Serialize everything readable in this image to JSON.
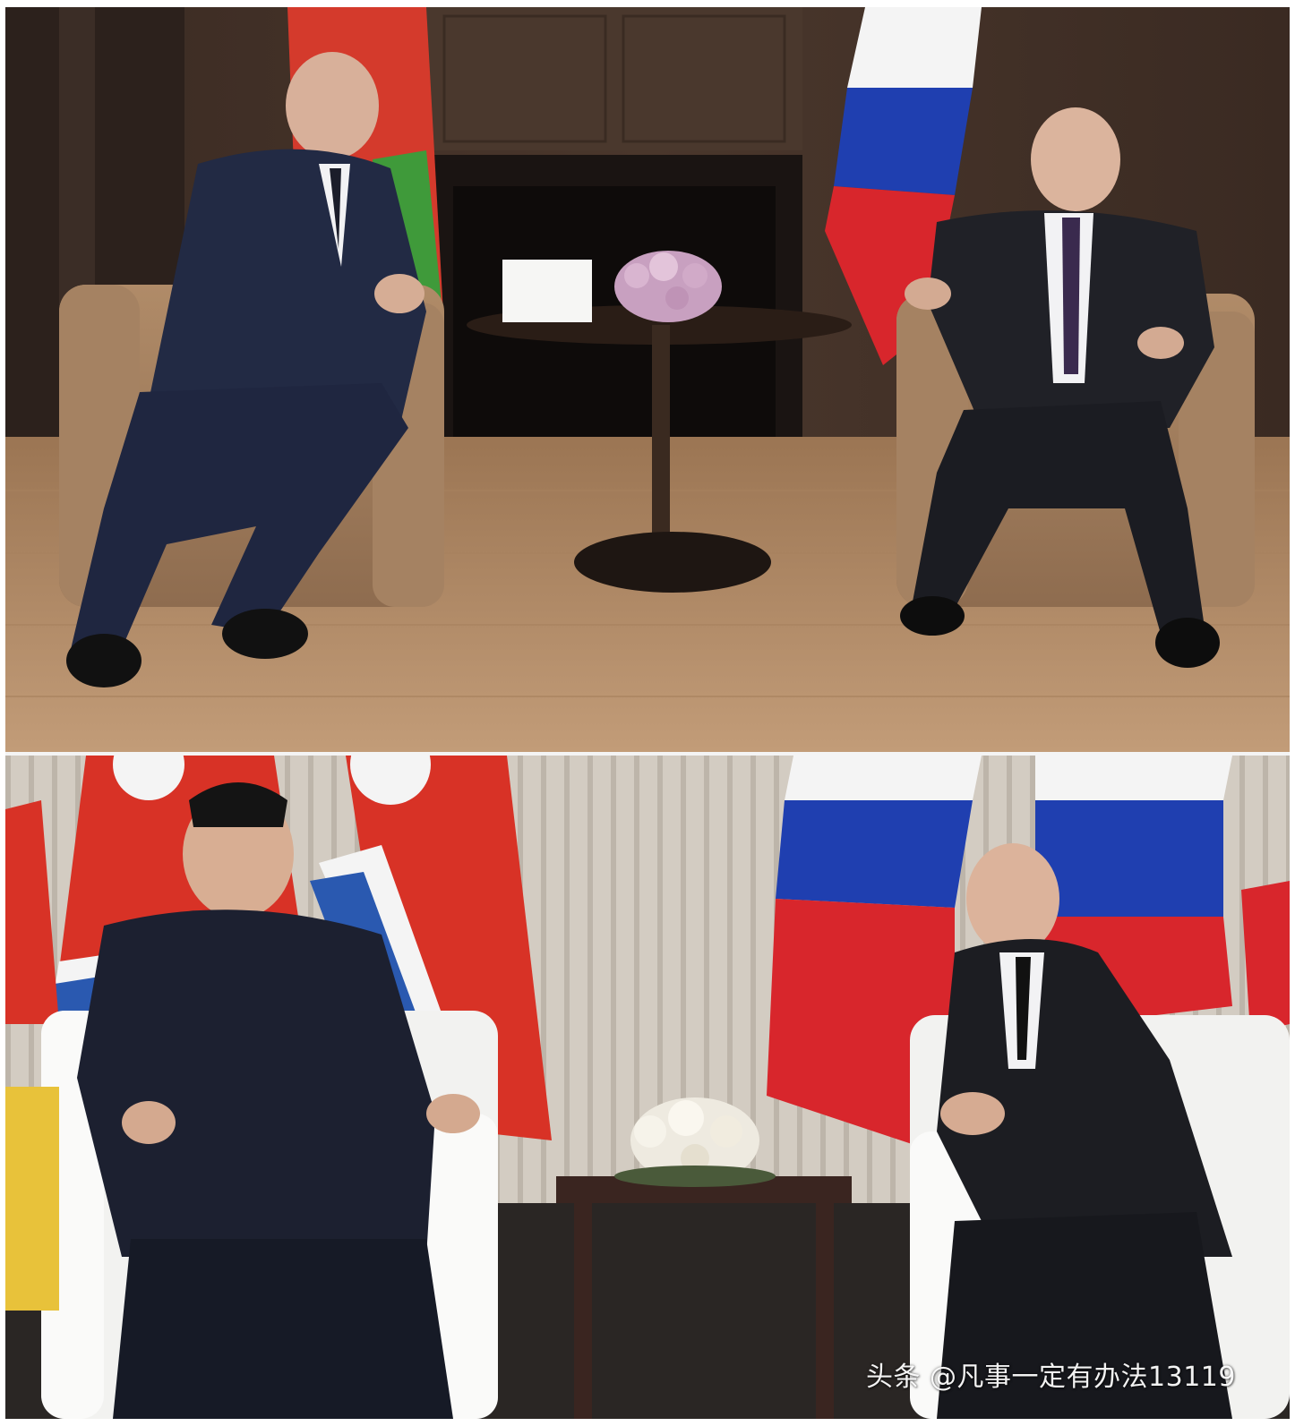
{
  "watermark": {
    "text": "头条 @凡事一定有办法13119"
  },
  "colors": {
    "russia_white": "#f4f4f4",
    "russia_blue": "#1f3fb0",
    "russia_red": "#d8262c",
    "belarus_red": "#d43a2c",
    "belarus_green": "#3f9a3a",
    "dprk_red": "#d83226",
    "dprk_blue": "#2a59b0"
  }
}
